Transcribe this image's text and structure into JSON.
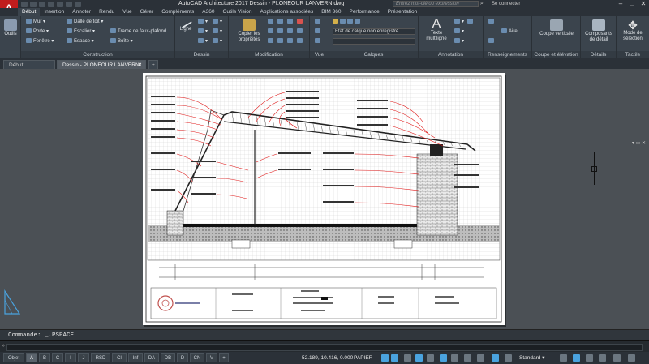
{
  "window": {
    "title": "AutoCAD Architecture 2017    Dessin - PLONEOUR LANVERN.dwg",
    "search_placeholder": "Entrez mot-clé ou expression",
    "signin": "Se connecter",
    "controls": [
      "–",
      "□",
      "✕"
    ]
  },
  "ribbon_tabs": [
    "Début",
    "Insertion",
    "Annoter",
    "Rendu",
    "Vue",
    "Gérer",
    "Compléments",
    "A360",
    "Outils Vision",
    "Applications associées",
    "BIM 360",
    "Performance",
    "Présentation"
  ],
  "ribbon": {
    "outils": "Outils",
    "construction": {
      "label": "Construction",
      "items": [
        "Mur",
        "Dalle de toit",
        "Porte",
        "Escalier",
        "Trame de faux-plafond",
        "Fenêtre",
        "Espace",
        "Boîte"
      ]
    },
    "dessin": {
      "label": "Dessin",
      "ligne": "Ligne"
    },
    "modification": {
      "label": "Modification",
      "copier": "Copier\nles propriétés"
    },
    "vue": {
      "label": "Vue"
    },
    "calques": {
      "label": "Calques",
      "layer_state": "Etat de calque non enregistré"
    },
    "annotation": {
      "label": "Annotation",
      "texte": "Texte multiligne"
    },
    "renseignements": {
      "label": "Renseignements",
      "aire": "Aire"
    },
    "coupe": {
      "label": "Coupe et élévation",
      "coupe_verticale": "Coupe verticale"
    },
    "details": {
      "label": "Détails",
      "composants": "Composants de détail"
    },
    "tactile": {
      "label": "Tactile",
      "mode": "Mode de sélection"
    }
  },
  "doc_tabs": [
    "Début",
    "Dessin - PLONEOUR LANVERN*"
  ],
  "command": {
    "history": "Commande: _.PSPACE",
    "prompt": "»"
  },
  "layout_tabs": [
    "Objet",
    "A",
    "B",
    "C",
    "I",
    "J",
    "RSD",
    "Cl",
    "Inf",
    "DA",
    "DB",
    "D",
    "CN",
    "V"
  ],
  "status": {
    "coords": "52.189, 10.416, 0.000",
    "space": "PAPIER",
    "anno_scale": "Standard"
  },
  "colors": {
    "accent": "#c01c1c",
    "ribbon_bg": "#3b444d",
    "canvas_bg": "#4b5055",
    "leader_red": "#e01818"
  }
}
